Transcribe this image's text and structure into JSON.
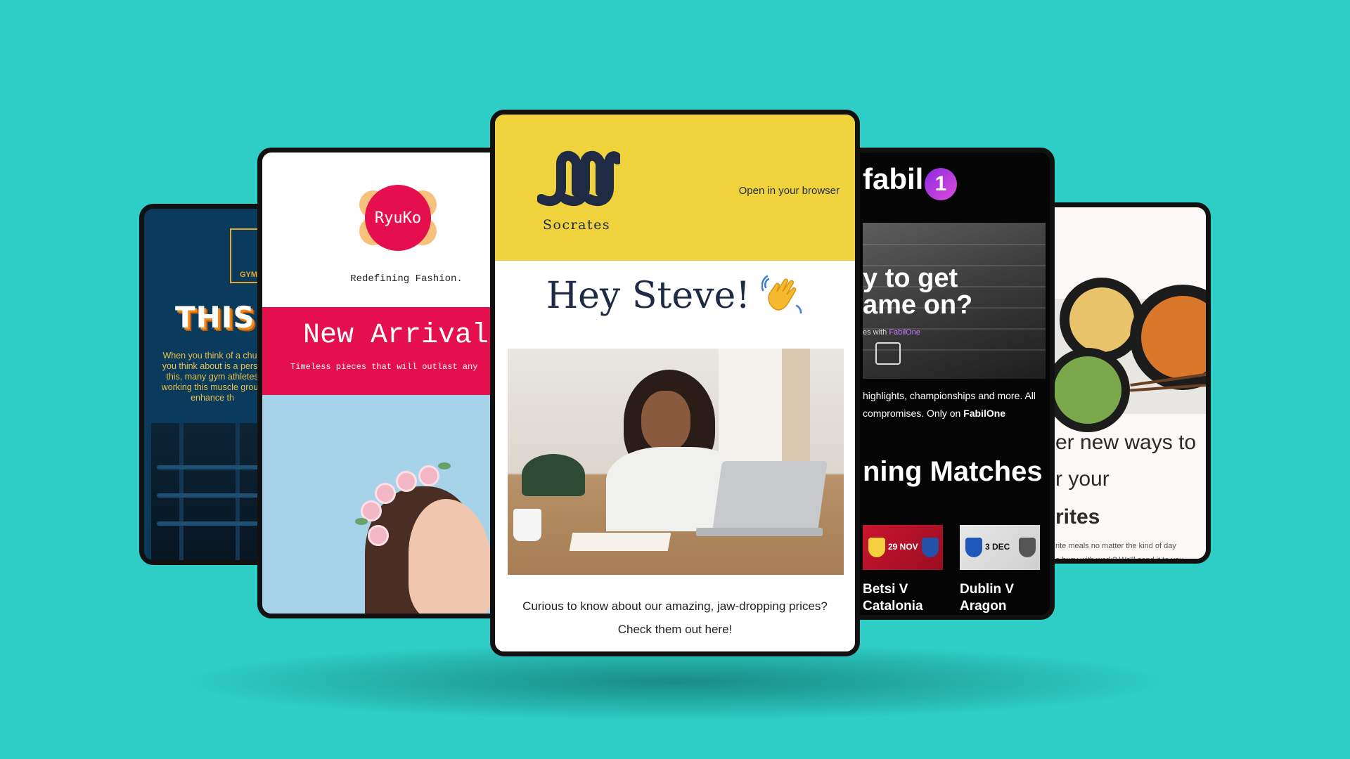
{
  "colors": {
    "background": "#2ecec6",
    "gym_bg": "#0a3a5c",
    "gym_accent": "#e7a72a",
    "ryuko_pink": "#e60f4e",
    "ryuko_photo": "#a6d3ea",
    "socrates_yellow": "#f0d23c",
    "socrates_navy": "#1f2b45",
    "fabil_bg": "#050505",
    "fabil_purple": "#c77dff"
  },
  "gym": {
    "logo_text": "GYM",
    "headline": "THIS W",
    "body_lines": [
      "When you think of a chun",
      "you think about is a perso",
      "this, many gym athletes",
      "working this muscle group",
      "enhance th"
    ]
  },
  "ryuko": {
    "logo": "RyuKo",
    "tagline": "Redefining Fashion.",
    "banner_title": "New Arrivals",
    "banner_sub": "Timeless pieces that will outlast any"
  },
  "socrates": {
    "logo_name": "Socrates",
    "open_browser": "Open in your browser",
    "greeting": "Hey Steve!",
    "wave_icon": "waving-hand-icon",
    "copy_line1": "Curious to know about our amazing, jaw-dropping prices?",
    "copy_line2": "Check them out here!"
  },
  "fabil": {
    "brand": "fabil",
    "brand_mark": "1",
    "hero_line1": "y to get",
    "hero_line2": "ame on?",
    "hero_small_prefix": "es with",
    "hero_small_brand": "FabilOne",
    "desc_line1": "highlights, championships and more. All",
    "desc_line2_prefix": "compromises. Only on",
    "desc_line2_brand": "FabilOne",
    "section_title": "ning Matches",
    "matches": [
      {
        "date": "29 NOV",
        "team1": "Betsi V",
        "team2": "Catalonia"
      },
      {
        "date": "3 DEC",
        "team1": "Dublin V",
        "team2": "Aragon"
      }
    ]
  },
  "food": {
    "line1": "er new ways to",
    "line2": "r your",
    "line3": "rites",
    "small1": "rite meals no matter the kind of day",
    "small2": "o busy with work? We'll send it to you."
  }
}
